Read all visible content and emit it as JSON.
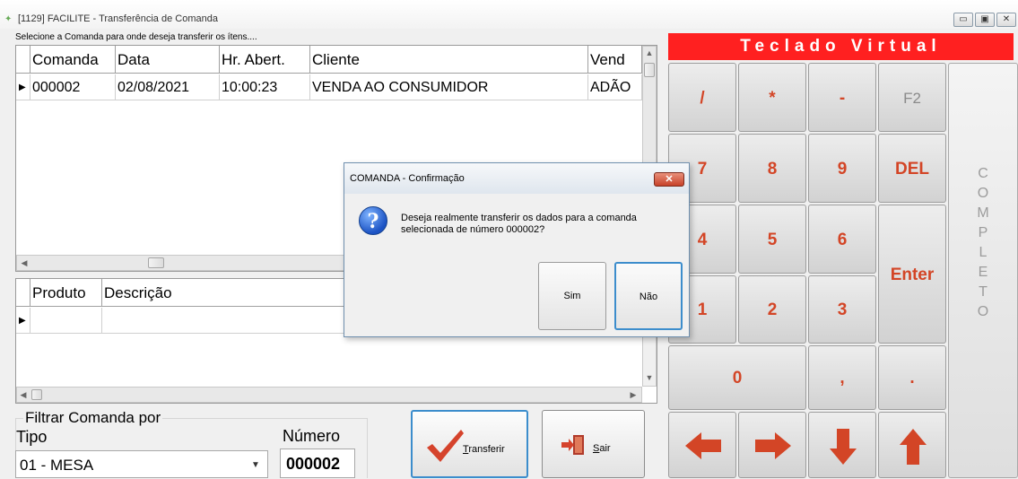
{
  "window": {
    "title": "[1129] FACILITE - Transferência de Comanda",
    "controls": [
      "minimize-icon",
      "maximize-icon",
      "close-icon"
    ]
  },
  "hint": "Selecione a Comanda para onde deseja transferir os ítens....",
  "comandas_table": {
    "columns": [
      "Comanda",
      "Data",
      "Hr. Abert.",
      "Cliente",
      "Vend"
    ],
    "rows": [
      [
        "000002",
        "02/08/2021",
        "10:00:23",
        "VENDA AO CONSUMIDOR",
        "ADÃO"
      ]
    ]
  },
  "produtos_table": {
    "columns": [
      "Produto",
      "Descrição"
    ]
  },
  "filter": {
    "title": "Filtrar Comanda por",
    "tipo_label": "Tipo",
    "tipo_value": "01 - MESA",
    "numero_label": "Número",
    "numero_value": "000002"
  },
  "buttons": {
    "transferir": "Transferir",
    "sair": "Sair"
  },
  "keyboard": {
    "title": "Teclado Virtual",
    "keys": [
      "/",
      "*",
      "-",
      "F2",
      "7",
      "8",
      "9",
      "DEL",
      "4",
      "5",
      "6",
      "Enter",
      "1",
      "2",
      "3",
      "0",
      ",",
      "."
    ],
    "completo": "COMPLETO",
    "arrows": [
      "arrow-left-icon",
      "arrow-right-icon",
      "arrow-down-icon",
      "arrow-up-icon"
    ],
    "key_color": "#d34526",
    "title_bg": "#ff2020"
  },
  "dialog": {
    "title": "COMANDA - Confirmação",
    "message": "Deseja realmente transferir os dados para a comanda selecionada de número 000002?",
    "yes": "Sim",
    "no": "Não",
    "icon": "info-icon"
  }
}
